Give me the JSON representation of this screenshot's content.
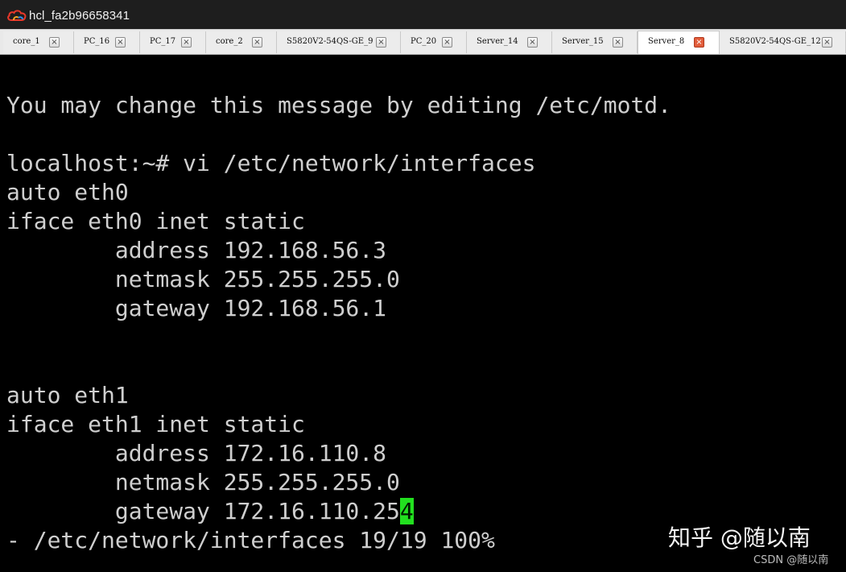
{
  "window": {
    "title": "hcl_fa2b96658341",
    "logo_icon": "cloud-icon",
    "logo_colors": [
      "#e8382b",
      "#f5a623",
      "#2d8cf0"
    ]
  },
  "tabs": [
    {
      "label": "core_1",
      "active": false
    },
    {
      "label": "PC_16",
      "active": false
    },
    {
      "label": "PC_17",
      "active": false
    },
    {
      "label": "core_2",
      "active": false
    },
    {
      "label": "S5820V2-54QS-GE_9",
      "active": false
    },
    {
      "label": "PC_20",
      "active": false
    },
    {
      "label": "Server_14",
      "active": false
    },
    {
      "label": "Server_15",
      "active": false
    },
    {
      "label": "Server_8",
      "active": true
    },
    {
      "label": "S5820V2-54QS-GE_12",
      "active": false
    }
  ],
  "tab_close_glyph": "×",
  "terminal": {
    "lines": [
      "You may change this message by editing /etc/motd.",
      "",
      "localhost:~# vi /etc/network/interfaces",
      "auto eth0",
      "iface eth0 inet static",
      "        address 192.168.56.3",
      "        netmask 255.255.255.0",
      "        gateway 192.168.56.1",
      "",
      "",
      "auto eth1",
      "iface eth1 inet static",
      "        address 172.16.110.8",
      "        netmask 255.255.255.0",
      "        gateway 172.16.110.25"
    ],
    "cursor_char": "4",
    "cursor_color": "#22e01f",
    "status_line": "- /etc/network/interfaces 19/19 100%"
  },
  "watermark": {
    "main": "知乎 @随以南",
    "sub": "CSDN @随以南"
  }
}
